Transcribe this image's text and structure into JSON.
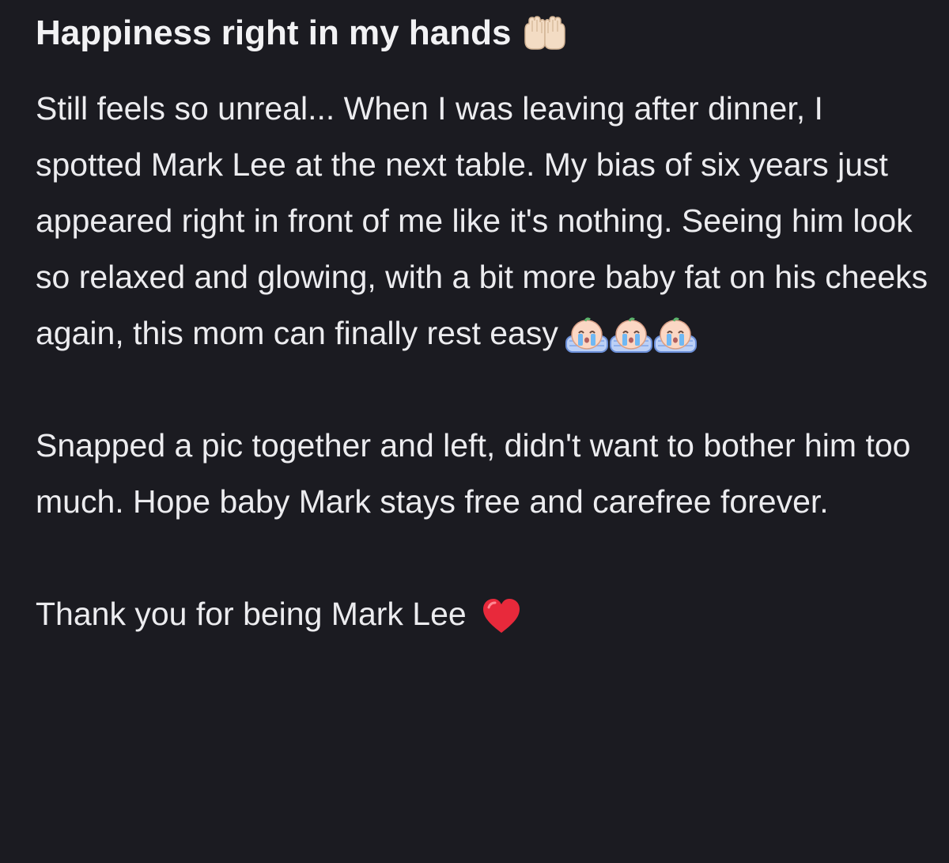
{
  "post": {
    "title": "Happiness right in my hands",
    "title_icon": "raised-hands-icon",
    "paragraph1": "Still feels so unreal... When I was leaving after dinner, I spotted Mark Lee at the next table. My bias of six years just appeared right in front of me like it's nothing. Seeing him look so relaxed and glowing, with a bit more baby fat on his cheeks again, this mom can finally rest easy",
    "paragraph1_icons": [
      "crying-baby-icon",
      "crying-baby-icon",
      "crying-baby-icon"
    ],
    "paragraph2": "Snapped a pic together and left, didn't want to bother him too much. Hope baby Mark stays free and carefree forever.",
    "paragraph3": "Thank you for being Mark Lee",
    "paragraph3_icon": "red-heart-icon",
    "colors": {
      "background": "#1b1b21",
      "text": "#ececef",
      "heart": "#e8293b"
    }
  }
}
